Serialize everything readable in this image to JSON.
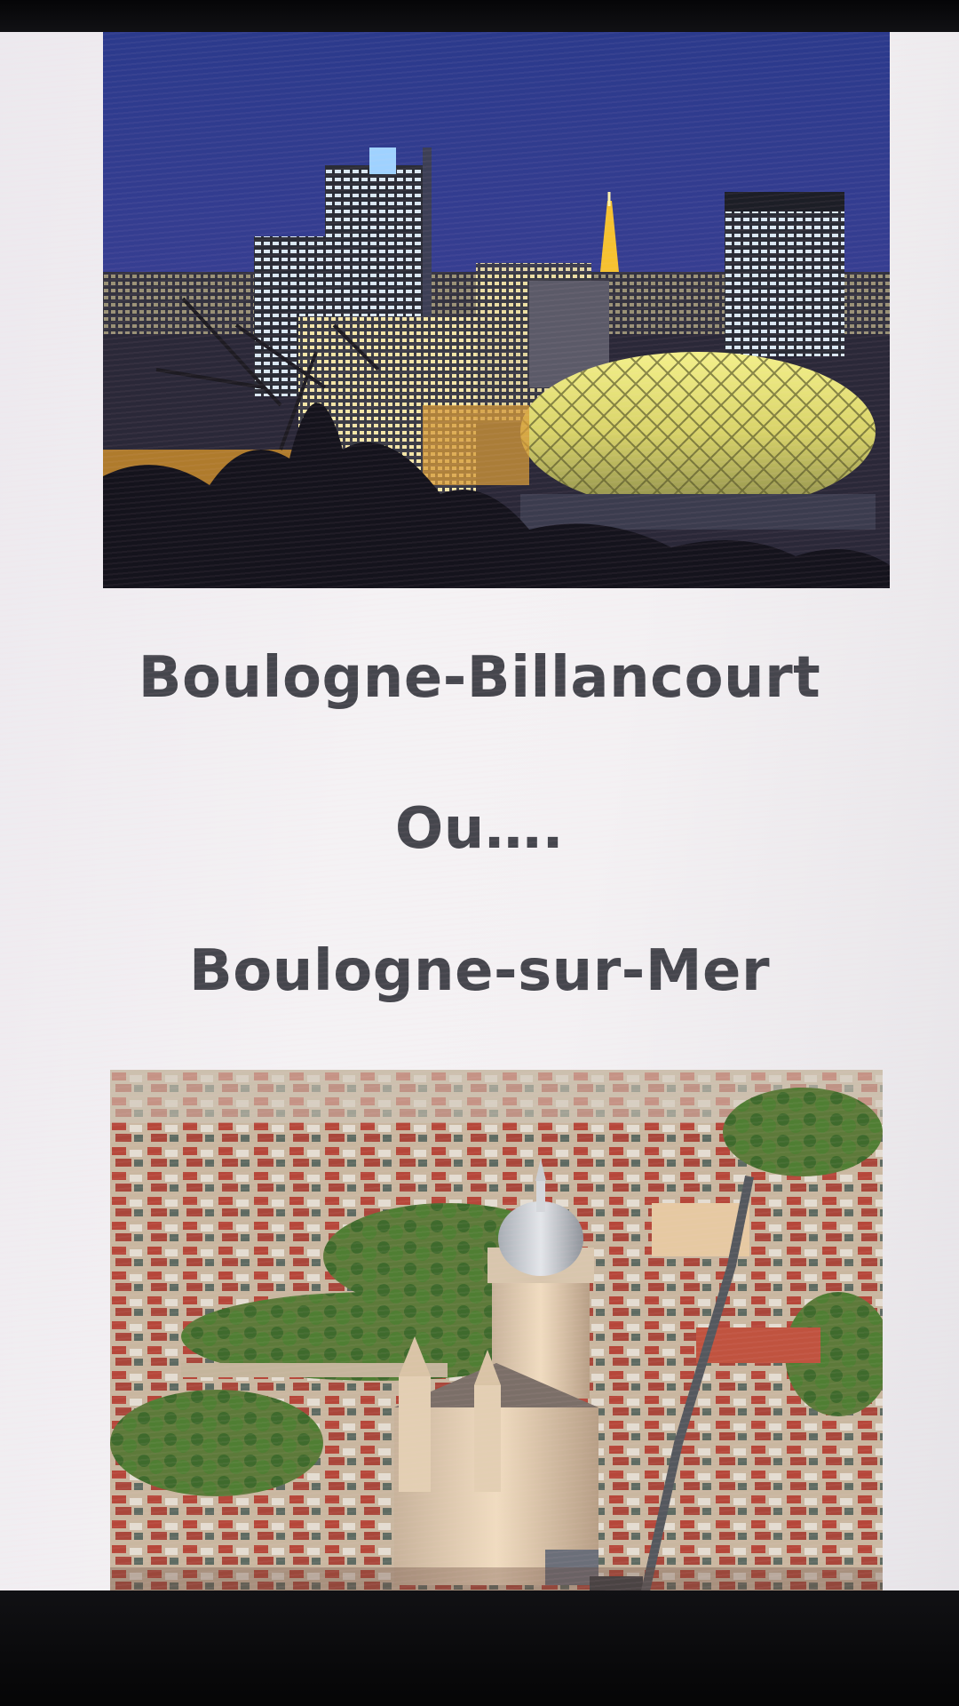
{
  "slide": {
    "title_1": "Boulogne-Billancourt",
    "separator": "Ou….",
    "title_2": "Boulogne-sur-Mer"
  },
  "images": {
    "top": "night city skyline with illuminated towers, lattice dome building and lit Eiffel Tower",
    "bottom": "aerial view of old town with domed basilica, red-roof houses and trees"
  }
}
